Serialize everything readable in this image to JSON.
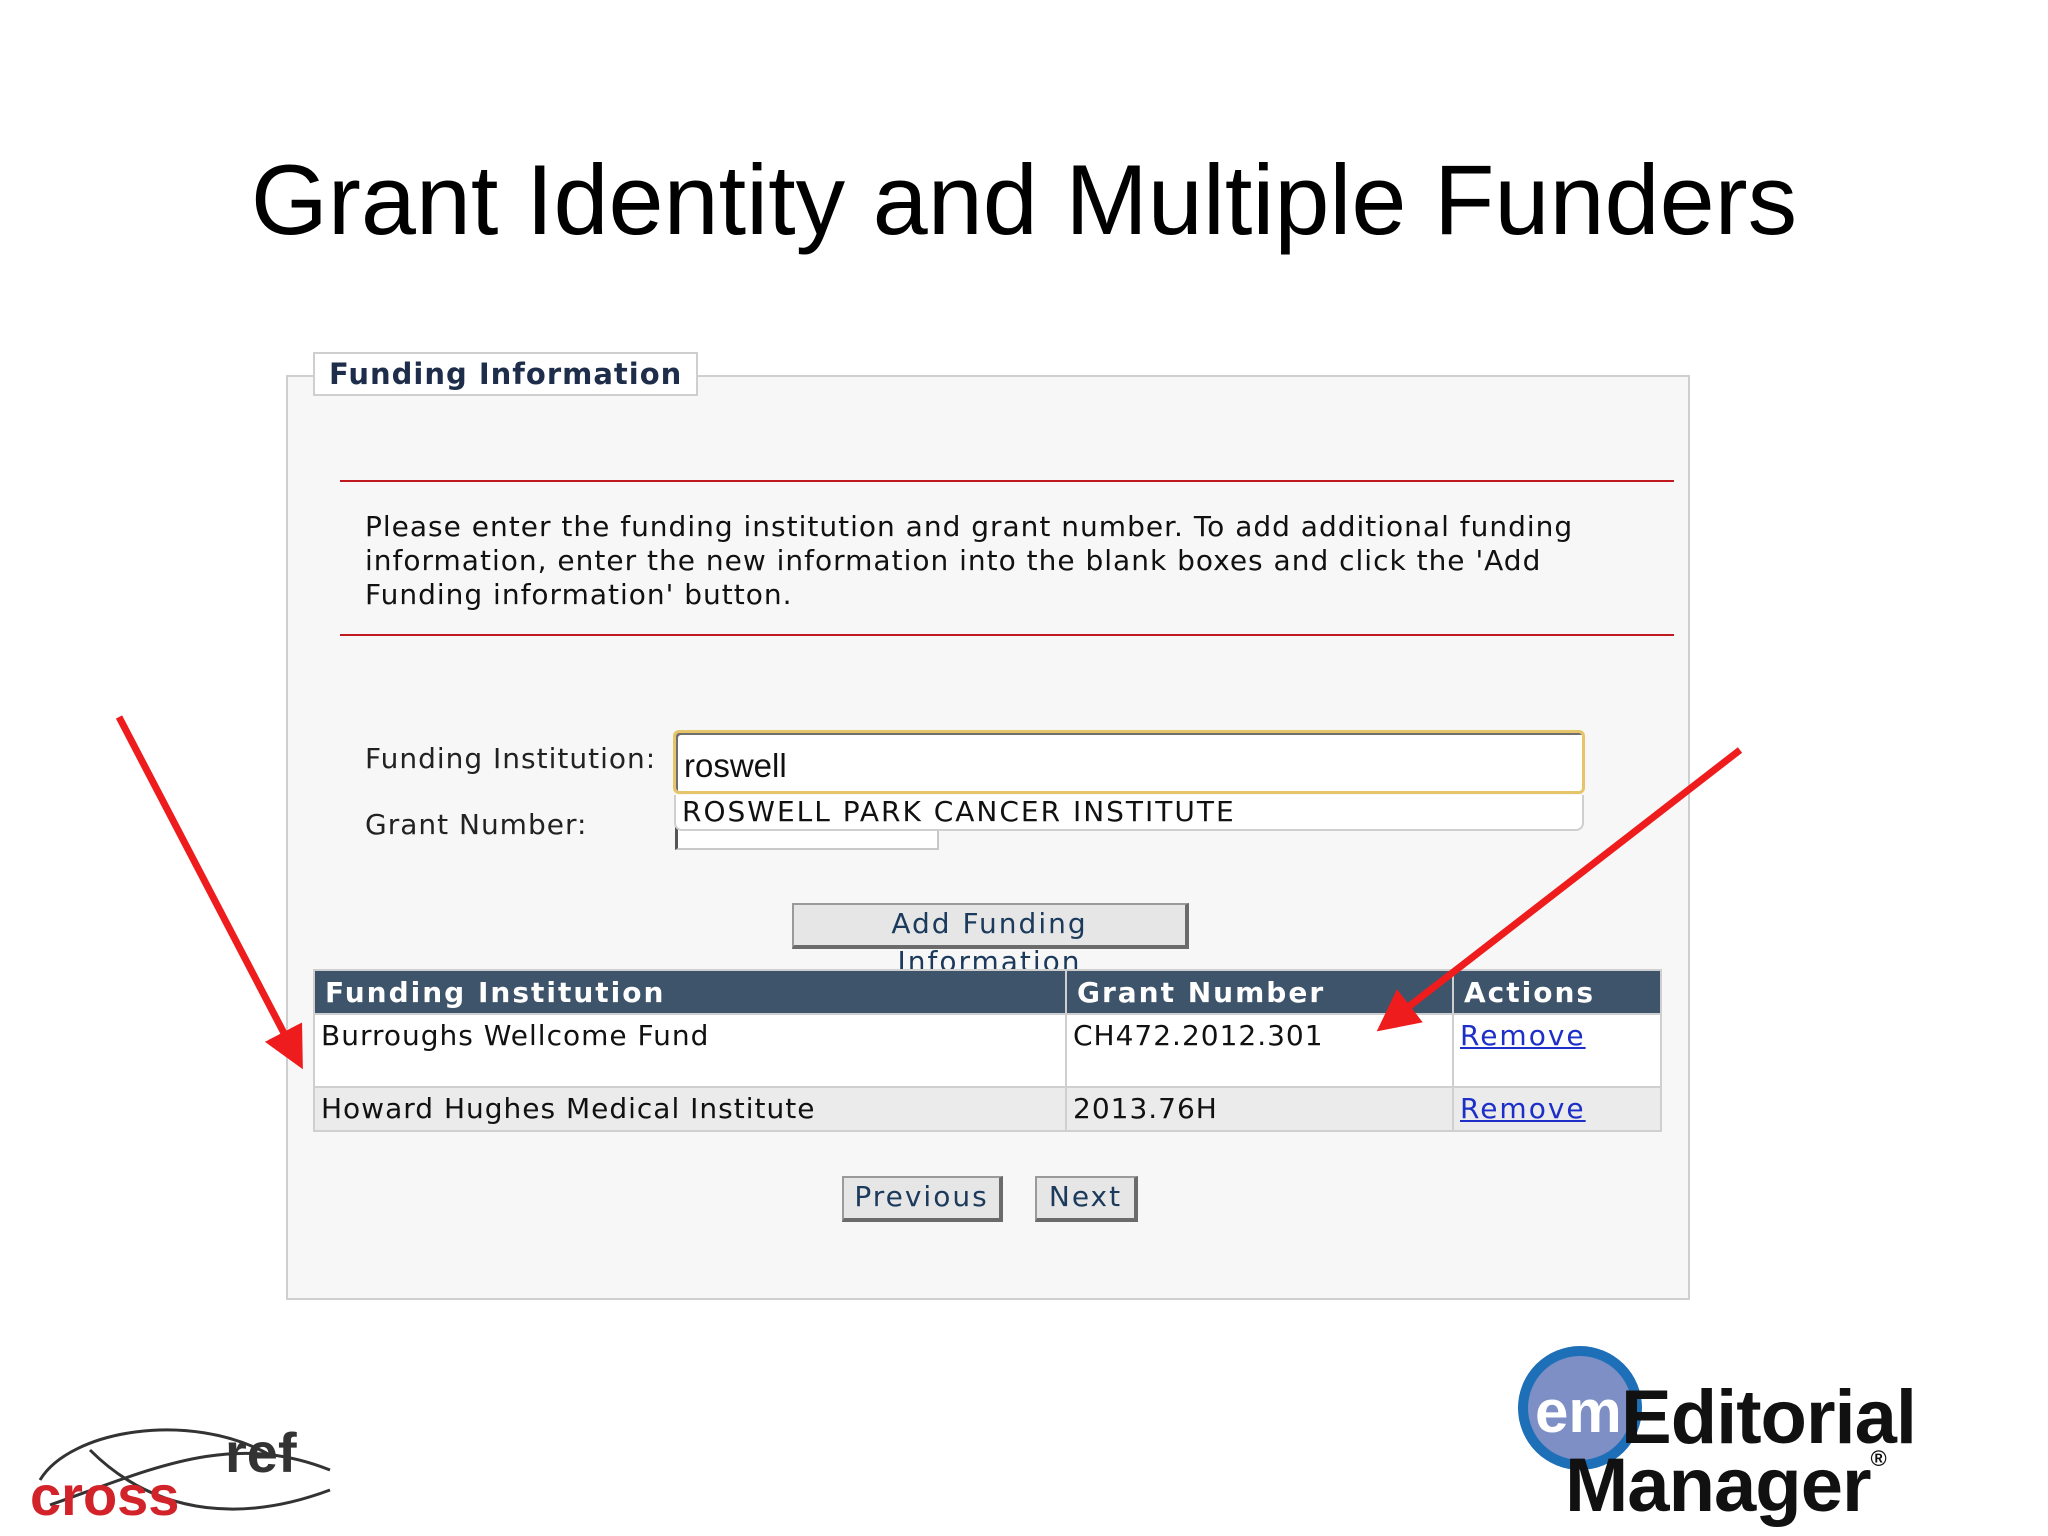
{
  "slide": {
    "title": "Grant Identity and Multiple Funders"
  },
  "panel": {
    "section_title": "Funding Information",
    "instructions": "Please enter the funding institution and grant number. To add additional funding information, enter the new information into the blank boxes and click the 'Add Funding information' button."
  },
  "form": {
    "institution_label": "Funding Institution:",
    "institution_value": "roswell",
    "grant_label": "Grant Number:",
    "grant_value": "",
    "suggestion": "ROSWELL PARK CANCER INSTITUTE",
    "add_button": "Add Funding Information"
  },
  "table": {
    "headers": [
      "Funding Institution",
      "Grant Number",
      "Actions"
    ],
    "rows": [
      {
        "institution": "Burroughs Wellcome Fund",
        "grant": "CH472.2012.301",
        "action": "Remove"
      },
      {
        "institution": "Howard Hughes Medical Institute",
        "grant": "2013.76H",
        "action": "Remove"
      }
    ]
  },
  "nav": {
    "previous": "Previous",
    "next": "Next"
  },
  "logos": {
    "crossref_cross": "cross",
    "crossref_ref": "ref",
    "em_badge": "em",
    "em_line1": "Editorial",
    "em_line2": "Manager",
    "em_registered": "®"
  },
  "colors": {
    "arrow": "#ee1c1c",
    "header_bg": "#3e546b",
    "rule": "#c0191f",
    "link": "#1d2fc8"
  }
}
